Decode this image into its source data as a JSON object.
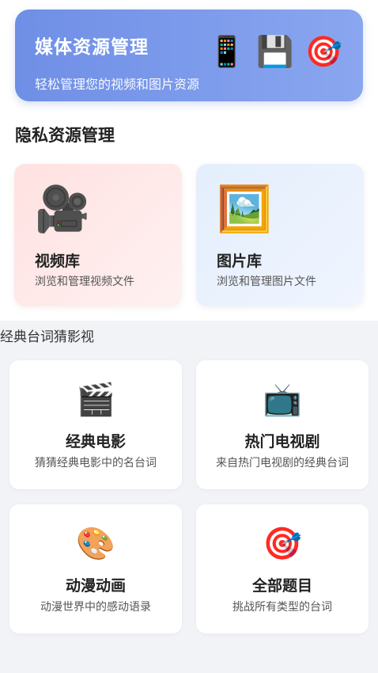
{
  "banner": {
    "title": "媒体资源管理",
    "subtitle": "轻松管理您的视频和图片资源",
    "icons": [
      "📱",
      "💾",
      "🎯"
    ],
    "gradient_start": "#6f8fe6",
    "gradient_end": "#8aa6f0"
  },
  "privacy_section": {
    "title": "隐私资源管理",
    "cards": [
      {
        "icon": "🎥",
        "icon_name": "movie-camera-icon",
        "title": "视频库",
        "description": "浏览和管理视频文件",
        "background": "#ffe1e1"
      },
      {
        "icon": "🖼️",
        "icon_name": "framed-picture-icon",
        "title": "图片库",
        "description": "浏览和管理图片文件",
        "background": "#e4eefc"
      }
    ]
  },
  "quiz_section": {
    "title": "经典台词猜影视",
    "cards": [
      {
        "icon": "🎬",
        "icon_name": "clapperboard-icon",
        "title": "经典电影",
        "description": "猜猜经典电影中的名台词"
      },
      {
        "icon": "📺",
        "icon_name": "television-icon",
        "title": "热门电视剧",
        "description": "来自热门电视剧的经典台词"
      },
      {
        "icon": "🎨",
        "icon_name": "palette-icon",
        "title": "动漫动画",
        "description": "动漫世界中的感动语录"
      },
      {
        "icon": "🎯",
        "icon_name": "target-icon",
        "title": "全部题目",
        "description": "挑战所有类型的台词"
      }
    ]
  }
}
